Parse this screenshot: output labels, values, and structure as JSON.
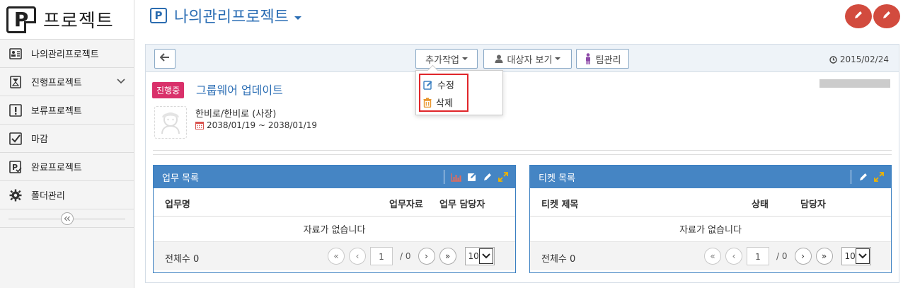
{
  "sidebar": {
    "brand_title": "프로젝트",
    "items": [
      {
        "label": "나의관리프로젝트",
        "icon": "person-card-icon"
      },
      {
        "label": "진행프로젝트",
        "icon": "hourglass-icon"
      },
      {
        "label": "보류프로젝트",
        "icon": "exclamation-icon"
      },
      {
        "label": "마감",
        "icon": "check-box-icon"
      },
      {
        "label": "완료프로젝트",
        "icon": "project-done-icon"
      },
      {
        "label": "폴더관리",
        "icon": "gear-icon"
      }
    ]
  },
  "header": {
    "title": "나의관리프로젝트"
  },
  "toolbar": {
    "more_actions_label": "추가작업",
    "target_view_label": "대상자 보기",
    "team_manage_label": "팀관리",
    "date": "2015/02/24"
  },
  "dropdown": {
    "edit_label": "수정",
    "delete_label": "삭제"
  },
  "project": {
    "status": "진행중",
    "title": "그룹웨어 업데이트",
    "owner": "한비로/한비로 (사장)",
    "period": "2038/01/19 ~ 2038/01/19"
  },
  "task_panel": {
    "title": "업무 목록",
    "columns": [
      "업무명",
      "업무자료",
      "업무 담당자"
    ],
    "empty_text": "자료가 없습니다",
    "total_label": "전체수 0",
    "page": "1",
    "page_of": "/ 0",
    "page_size": "10"
  },
  "ticket_panel": {
    "title": "티켓 목록",
    "columns": [
      "티켓 제목",
      "상태",
      "담당자"
    ],
    "empty_text": "자료가 없습니다",
    "total_label": "전체수 0",
    "page": "1",
    "page_of": "/ 0",
    "page_size": "10"
  },
  "colors": {
    "accent_blue": "#2a6db4",
    "panel_header": "#4585c4",
    "status_badge": "#d9306a",
    "round_button": "#d24b3e",
    "highlight_frame": "#e0262a"
  }
}
